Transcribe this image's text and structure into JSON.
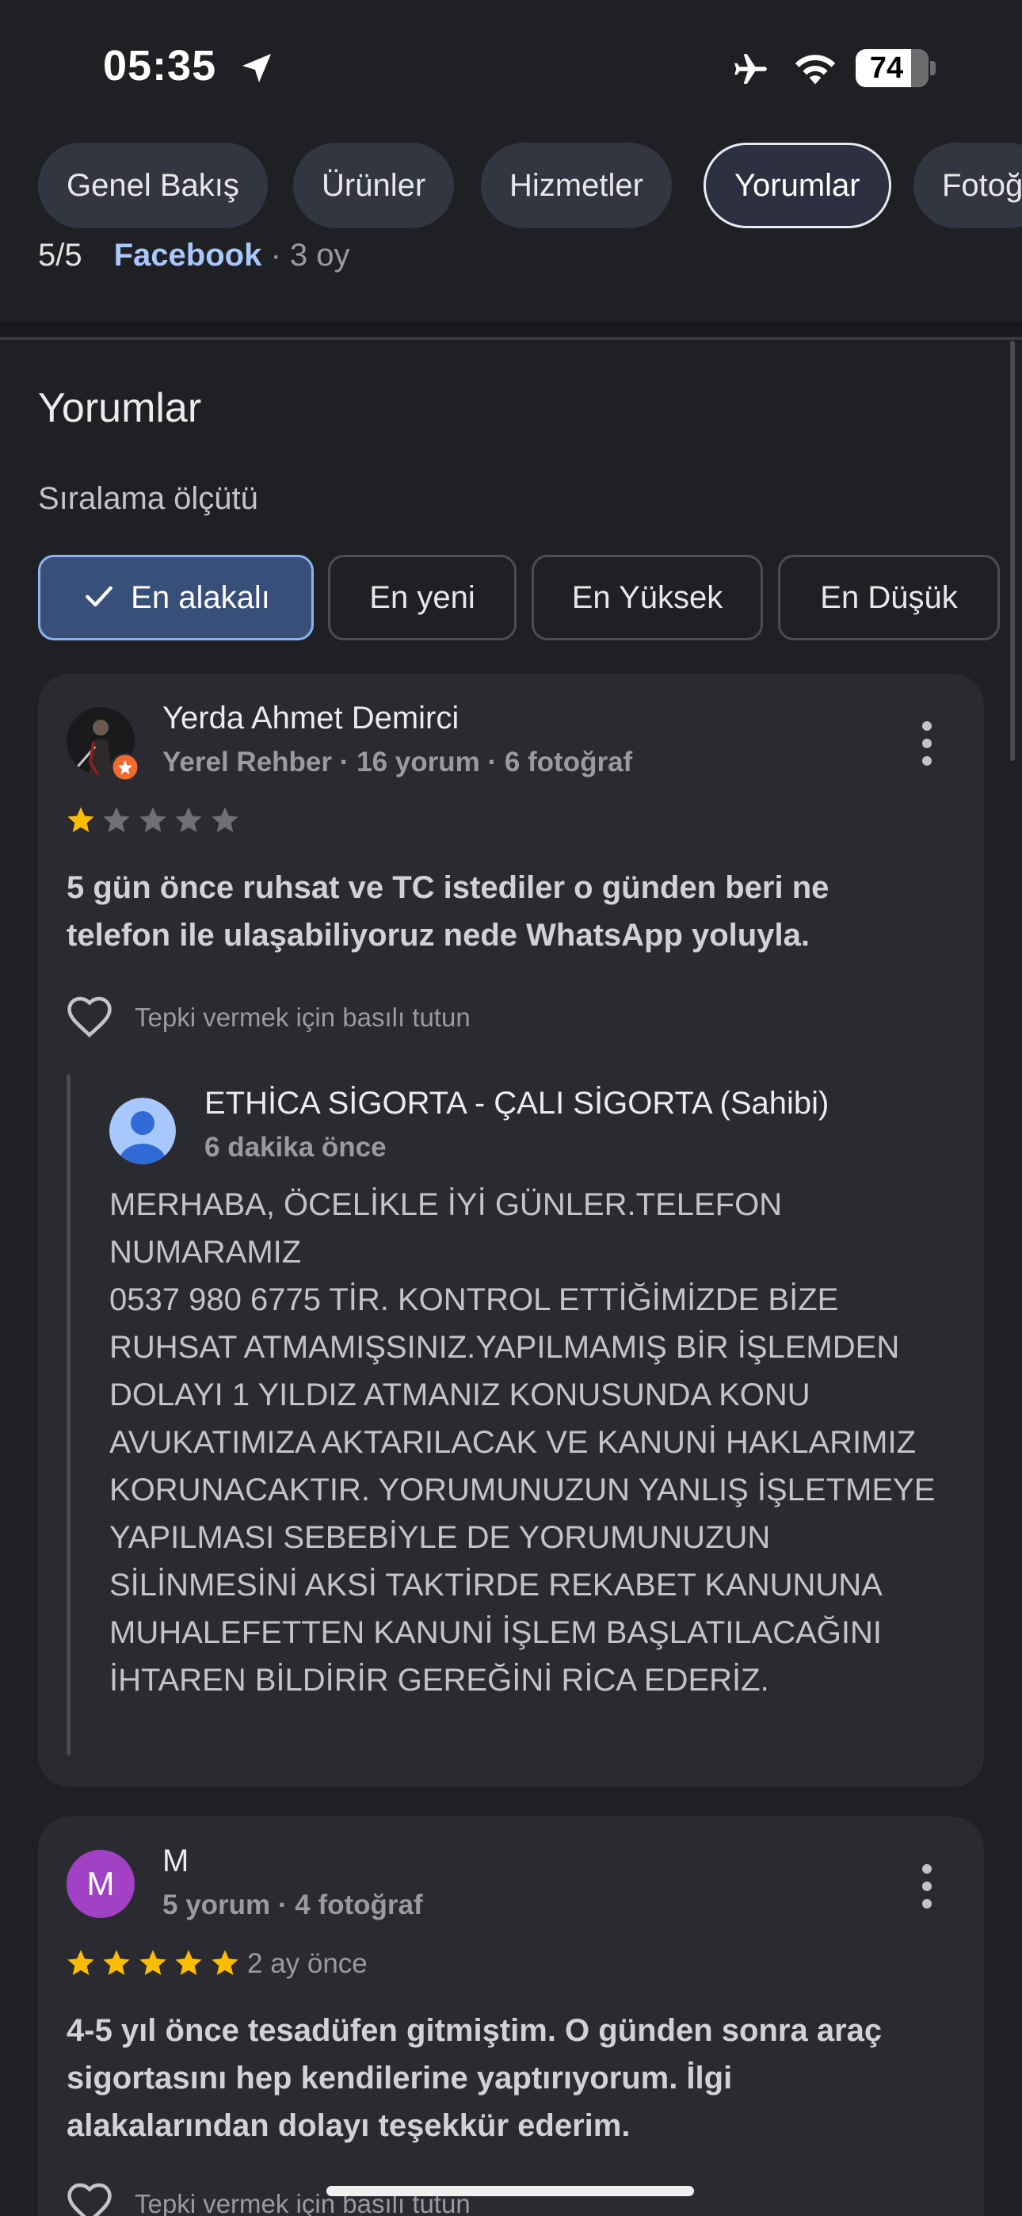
{
  "status_bar": {
    "time": "05:35",
    "battery": "74"
  },
  "tabs": [
    {
      "label": "Genel Bakış"
    },
    {
      "label": "Ürünler"
    },
    {
      "label": "Hizmetler"
    },
    {
      "label": "Yorumlar"
    },
    {
      "label": "Fotoğ"
    }
  ],
  "previous_review": {
    "rating": "5/5",
    "source": "Facebook",
    "ago": " · 3 oy"
  },
  "reviews_section": {
    "title": "Yorumlar",
    "sort_label": "Sıralama ölçütü",
    "sort_options": [
      {
        "label": "En alakalı",
        "selected": true
      },
      {
        "label": "En yeni",
        "selected": false
      },
      {
        "label": "En Yüksek",
        "selected": false
      },
      {
        "label": "En Düşük",
        "selected": false
      }
    ]
  },
  "reviews": [
    {
      "name": "Yerda Ahmet Demirci",
      "meta": "Yerel Rehber · 16 yorum · 6 fotoğraf",
      "rating": 1,
      "text": "5 gün önce ruhsat ve TC istediler o günden beri ne telefon ile ulaşabiliyoruz nede WhatsApp yoluyla.",
      "react_label": "Tepki vermek için basılı tutun",
      "owner_reply": {
        "name": "ETHİCA SİGORTA - ÇALI SİGORTA (Sahibi)",
        "time": "6 dakika önce",
        "text": "MERHABA, ÖCELİKLE İYİ GÜNLER.TELEFON NUMARAMIZ\n0537 980 6775 TİR. KONTROL ETTİĞİMİZDE BİZE RUHSAT ATMAMIŞSINIZ.YAPILMAMIŞ BİR İŞLEMDEN DOLAYI 1 YILDIZ ATMANIZ KONUSUNDA KONU AVUKATIMIZA AKTARILACAK VE KANUNİ HAKLARIMIZ KORUNACAKTIR. YORUMUNUZUN YANLIŞ İŞLETMEYE YAPILMASI SEBEBİYLE DE YORUMUNUZUN SİLİNMESİNİ AKSİ TAKTİRDE REKABET KANUNUNA MUHALEFETTEN KANUNİ İŞLEM BAŞLATILACAĞINI İHTAREN BİLDİRİR GEREĞİNİ RİCA EDERİZ."
      }
    },
    {
      "name": "M",
      "avatar_letter": "M",
      "meta": "5 yorum · 4 fotoğraf",
      "rating": 5,
      "time": "2 ay önce",
      "text": "4-5 yıl önce tesadüfen gitmiştim. O günden sonra araç sigortasını hep kendilerine yaptırıyorum. İlgi alakalarından dolayı teşekkür ederim.",
      "react_label": "Tepki vermek için basılı tutun"
    }
  ],
  "colors": {
    "accent": "#a8c7fa",
    "star": "#fbbc04",
    "background": "#1f2024"
  }
}
